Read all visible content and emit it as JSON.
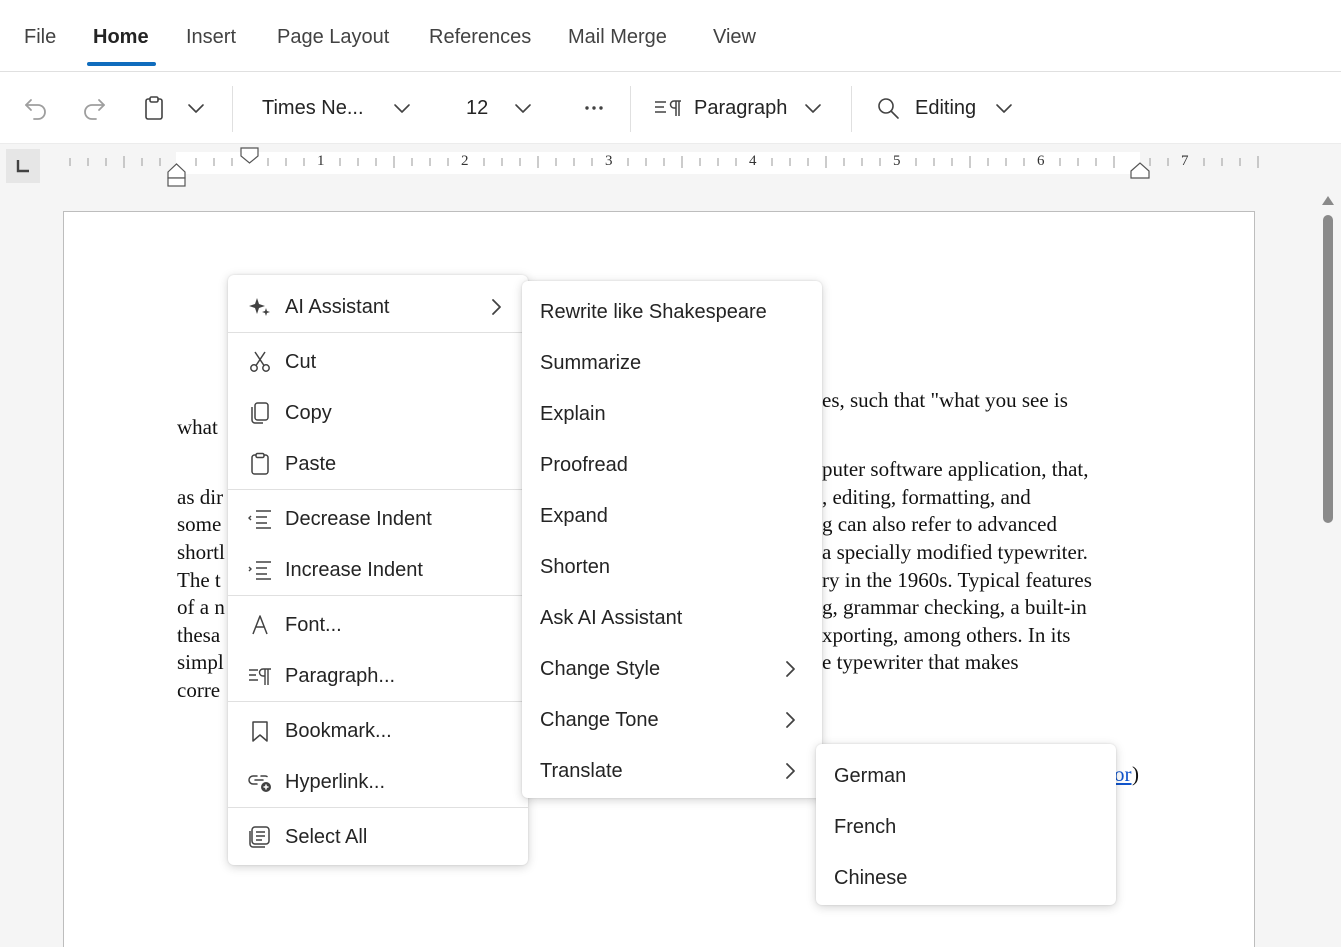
{
  "ribbon": {
    "tabs": [
      "File",
      "Home",
      "Insert",
      "Page Layout",
      "References",
      "Mail Merge",
      "View"
    ],
    "active_tab": "Home"
  },
  "toolbar": {
    "font_name": "Times Ne...",
    "font_size": "12",
    "paragraph_label": "Paragraph",
    "editing_label": "Editing"
  },
  "ruler": {
    "numbers": [
      "1",
      "2",
      "3",
      "4",
      "5",
      "6",
      "7"
    ]
  },
  "document": {
    "line_1": "es, such that \"what you see is",
    "line_2": "what",
    "line_3": "puter software application, that,",
    "line_4_left": "as dir",
    "line_4_right": ", editing, formatting, and",
    "line_5_left": "some",
    "line_5_right": "g can also refer to advanced",
    "line_6_left": "shortl",
    "line_6_right": "a specially modified typewriter.",
    "line_7_left": "The t",
    "line_7_right": "ry in the 1960s. Typical features",
    "line_8_left": "of a n",
    "line_8_right": "g, grammar checking, a built-in",
    "line_9_left": "thesa",
    "line_9_right": "xporting, among others. In its",
    "line_10_left": "simpl",
    "line_10_right": "e typewriter that makes",
    "line_11_left": "corre",
    "link_text": "or",
    "link_suffix": ")"
  },
  "context_menu": {
    "ai_assistant": "AI Assistant",
    "cut": "Cut",
    "copy": "Copy",
    "paste": "Paste",
    "decrease_indent": "Decrease Indent",
    "increase_indent": "Increase Indent",
    "font": "Font...",
    "paragraph": "Paragraph...",
    "bookmark": "Bookmark...",
    "hyperlink": "Hyperlink...",
    "select_all": "Select All"
  },
  "ai_submenu": {
    "rewrite": "Rewrite like Shakespeare",
    "summarize": "Summarize",
    "explain": "Explain",
    "proofread": "Proofread",
    "expand": "Expand",
    "shorten": "Shorten",
    "ask": "Ask AI Assistant",
    "change_style": "Change Style",
    "change_tone": "Change Tone",
    "translate": "Translate"
  },
  "translate_submenu": {
    "german": "German",
    "french": "French",
    "chinese": "Chinese"
  },
  "colors": {
    "accent": "#0f6cbd",
    "link": "#1155cc"
  }
}
